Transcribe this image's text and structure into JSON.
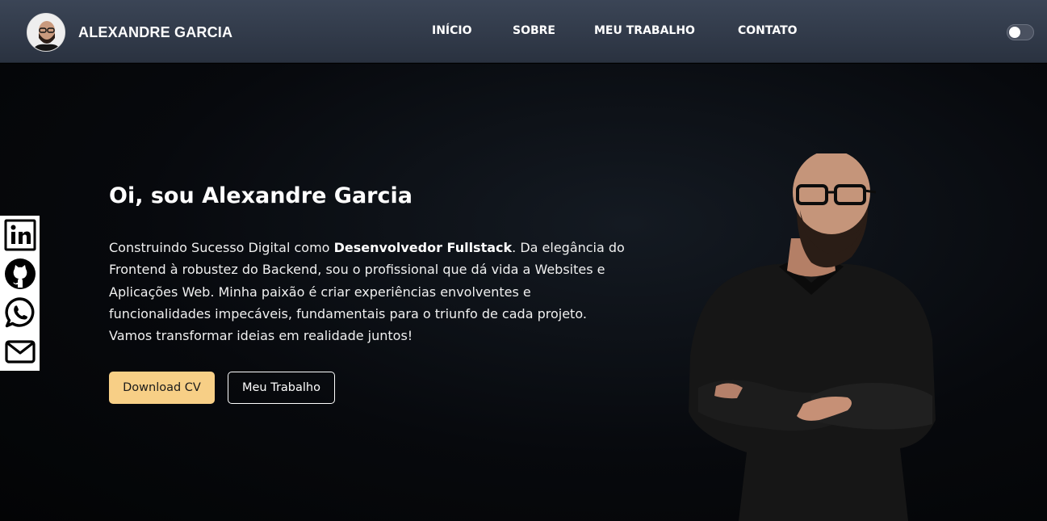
{
  "header": {
    "brand_name": "ALEXANDRE GARCIA",
    "nav": [
      {
        "label": "INÍCIO"
      },
      {
        "label": "SOBRE"
      },
      {
        "label": "MEU TRABALHO"
      },
      {
        "label": "CONTATO"
      }
    ],
    "theme_toggle": {
      "state": "off"
    }
  },
  "hero": {
    "title": "Oi, sou Alexandre Garcia",
    "text_before": "Construindo Sucesso Digital como ",
    "text_bold": "Desenvolvedor Fullstack",
    "text_after": ". Da elegância do Frontend à robustez do Backend, sou o profissional que dá vida a Websites e Aplicações Web. Minha paixão é criar experiências envolventes e funcionalidades impecáveis, fundamentais para o triunfo de cada projeto. Vamos transformar ideias em realidade juntos!",
    "primary_button": "Download CV",
    "secondary_button": "Meu Trabalho"
  },
  "social": [
    {
      "icon": "linkedin-icon"
    },
    {
      "icon": "github-icon"
    },
    {
      "icon": "whatsapp-icon"
    },
    {
      "icon": "mail-icon"
    }
  ],
  "colors": {
    "accent": "#f7cf86",
    "header_bg": "#333c4b",
    "page_bg": "#05070a"
  }
}
